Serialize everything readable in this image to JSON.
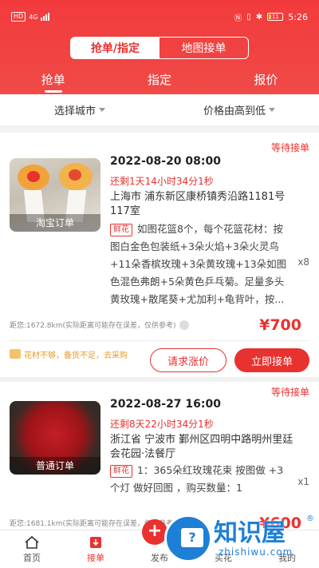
{
  "status_bar": {
    "time": "5:26",
    "battery": "11",
    "left_chips": [
      "HD",
      "4G"
    ]
  },
  "segment": {
    "active": "抢单/指定",
    "inactive": "地图接单"
  },
  "tabs": [
    {
      "label": "抢单",
      "active": true
    },
    {
      "label": "指定",
      "active": false
    },
    {
      "label": "报价",
      "active": false
    }
  ],
  "filters": {
    "city": "选择城市",
    "sort": "价格由高到低"
  },
  "orders": [
    {
      "status": "等待接单",
      "thumb_tag": "淘宝订单",
      "datetime": "2022-08-20 08:00",
      "remaining": "还剩1天14小时34分1秒",
      "address": "上海市 浦东新区康桥镇秀沿路1181号117室",
      "category": "鲜花",
      "description": "如图花篮8个，每个花篮花材：按图白金色包装纸+3朵火焰+3朵火灵鸟+11朵香槟玫瑰+3朵黄玫瑰+13朵如图色混色弗朗+5朵黄色乒乓菊。足量多头黄玫瑰+散尾葵+尤加利+龟背叶，按...",
      "quantity": "x8",
      "distance": "距您:1672.8km(实际距离可能存在误差，仅供参考)",
      "price": "¥700",
      "note": "花材不够，备货不足，去采购",
      "btn_raise": "请求涨价",
      "btn_accept": "立即接单"
    },
    {
      "status": "等待接单",
      "thumb_tag": "普通订单",
      "datetime": "2022-08-27 16:00",
      "remaining": "还剩8天22小时34分1秒",
      "address": "浙江省 宁波市 鄞州区四明中路明州里廷会花园·法餐厅",
      "category": "鲜花",
      "description": "1：365朵红玫瑰花束 按图做 +3个灯 做好回图 ，购买数量：1",
      "quantity": "x1",
      "distance": "距您:1681.1km(实际距离可能存在误差，仅供参考)",
      "price": "¥600"
    }
  ],
  "bottom_nav": [
    {
      "label": "首页",
      "icon": "home-icon",
      "active": false
    },
    {
      "label": "接单",
      "icon": "order-receive-icon",
      "active": true
    },
    {
      "label": "发布",
      "icon": "publish-icon",
      "active": false
    },
    {
      "label": "买花",
      "icon": "cart-icon",
      "active": false
    },
    {
      "label": "我的",
      "icon": "profile-icon",
      "active": false
    }
  ],
  "watermark": {
    "cn": "知识屋",
    "en": "zhishiwu.com",
    "mark": "®"
  },
  "colors": {
    "accent": "#e8322f",
    "note": "#e79a2b",
    "watermark": "#1e7fd6"
  }
}
